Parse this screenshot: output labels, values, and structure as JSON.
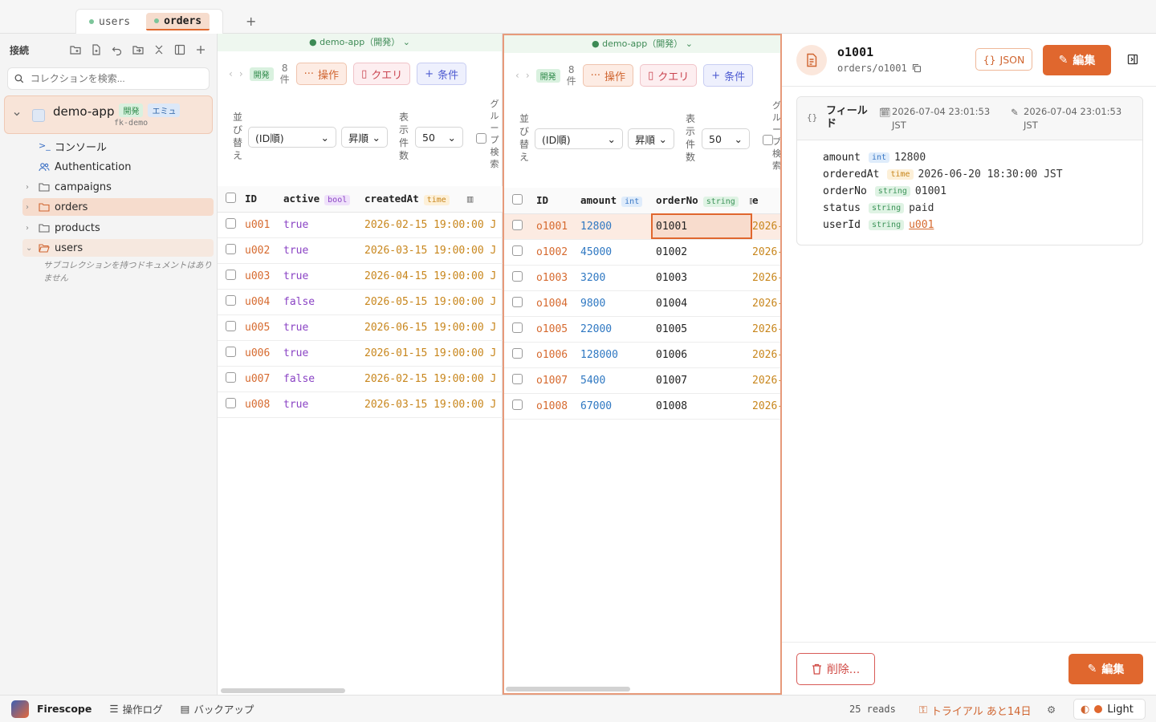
{
  "tabs": [
    {
      "label": "users"
    },
    {
      "label": "orders"
    }
  ],
  "sidebar": {
    "title": "接続",
    "search_placeholder": "コレクションを検索...",
    "connection": {
      "name": "demo-app",
      "badge_env": "開発",
      "badge_emu": "エミュ",
      "project": "fk-demo"
    },
    "items": [
      {
        "label": "コンソール"
      },
      {
        "label": "Authentication"
      },
      {
        "label": "campaigns"
      },
      {
        "label": "orders"
      },
      {
        "label": "products"
      },
      {
        "label": "users"
      }
    ],
    "note": "サブコレクションを持つドキュメントはありません"
  },
  "paneA": {
    "header": "demo-app（開発）",
    "env_badge": "開発",
    "count_num": "8",
    "count_unit": "件",
    "btn_ops": "操作",
    "btn_query": "クエリ",
    "btn_cond": "条件",
    "sort_label": "並び替え",
    "sort_value": "(ID順)",
    "order_value": "昇順",
    "per_page_label": "表示件数",
    "per_page_value": "50",
    "group_label": "グループ検索",
    "columns": [
      {
        "name": "ID"
      },
      {
        "name": "active",
        "type": "bool"
      },
      {
        "name": "createdAt",
        "type": "time"
      }
    ],
    "rows": [
      {
        "id": "u001",
        "active": "true",
        "createdAt": "2026-02-15 19:00:00 J"
      },
      {
        "id": "u002",
        "active": "true",
        "createdAt": "2026-03-15 19:00:00 J"
      },
      {
        "id": "u003",
        "active": "true",
        "createdAt": "2026-04-15 19:00:00 J"
      },
      {
        "id": "u004",
        "active": "false",
        "createdAt": "2026-05-15 19:00:00 J"
      },
      {
        "id": "u005",
        "active": "true",
        "createdAt": "2026-06-15 19:00:00 J"
      },
      {
        "id": "u006",
        "active": "true",
        "createdAt": "2026-01-15 19:00:00 J"
      },
      {
        "id": "u007",
        "active": "false",
        "createdAt": "2026-02-15 19:00:00 J"
      },
      {
        "id": "u008",
        "active": "true",
        "createdAt": "2026-03-15 19:00:00 J"
      }
    ]
  },
  "paneB": {
    "header": "demo-app（開発）",
    "env_badge": "開発",
    "count_num": "8",
    "count_unit": "件",
    "btn_ops": "操作",
    "btn_query": "クエリ",
    "btn_cond": "条件",
    "sort_label": "並び替え",
    "sort_value": "(ID順)",
    "order_value": "昇順",
    "per_page_label": "表示件数",
    "per_page_value": "50",
    "group_label": "グループ検索",
    "columns": [
      {
        "name": "ID"
      },
      {
        "name": "amount",
        "type": "int"
      },
      {
        "name": "orderNo",
        "type": "string"
      },
      {
        "name": "e"
      }
    ],
    "rows": [
      {
        "id": "o1001",
        "amount": "12800",
        "orderNo": "01001",
        "extra": "2026-"
      },
      {
        "id": "o1002",
        "amount": "45000",
        "orderNo": "01002",
        "extra": "2026-"
      },
      {
        "id": "o1003",
        "amount": "3200",
        "orderNo": "01003",
        "extra": "2026-"
      },
      {
        "id": "o1004",
        "amount": "9800",
        "orderNo": "01004",
        "extra": "2026-"
      },
      {
        "id": "o1005",
        "amount": "22000",
        "orderNo": "01005",
        "extra": "2026-"
      },
      {
        "id": "o1006",
        "amount": "128000",
        "orderNo": "01006",
        "extra": "2026-"
      },
      {
        "id": "o1007",
        "amount": "5400",
        "orderNo": "01007",
        "extra": "2026-"
      },
      {
        "id": "o1008",
        "amount": "67000",
        "orderNo": "01008",
        "extra": "2026-"
      }
    ]
  },
  "detail": {
    "title": "o1001",
    "path": "orders/o1001",
    "btn_json": "JSON",
    "btn_edit": "編集",
    "fields_label": "フィールド",
    "created": "2026-07-04 23:01:53 JST",
    "updated": "2026-07-04 23:01:53 JST",
    "fields": [
      {
        "key": "amount",
        "type": "int",
        "value": "12800"
      },
      {
        "key": "orderedAt",
        "type": "time",
        "value": "2026-06-20 18:30:00 JST"
      },
      {
        "key": "orderNo",
        "type": "string",
        "value": "01001"
      },
      {
        "key": "status",
        "type": "string",
        "value": "paid"
      },
      {
        "key": "userId",
        "type": "string",
        "value": "u001"
      }
    ],
    "btn_delete": "削除...",
    "btn_edit_bottom": "編集"
  },
  "status": {
    "app": "Firescope",
    "log": "操作ログ",
    "backup": "バックアップ",
    "reads": "25 reads",
    "trial": "トライアル あと14日",
    "theme": "Light"
  },
  "colors": {
    "accent": "#e0672e",
    "id": "#d66a2f",
    "bool": "#8a43c4",
    "time": "#c8861c",
    "int": "#2f78c2",
    "string_badge": "#3e945a"
  }
}
